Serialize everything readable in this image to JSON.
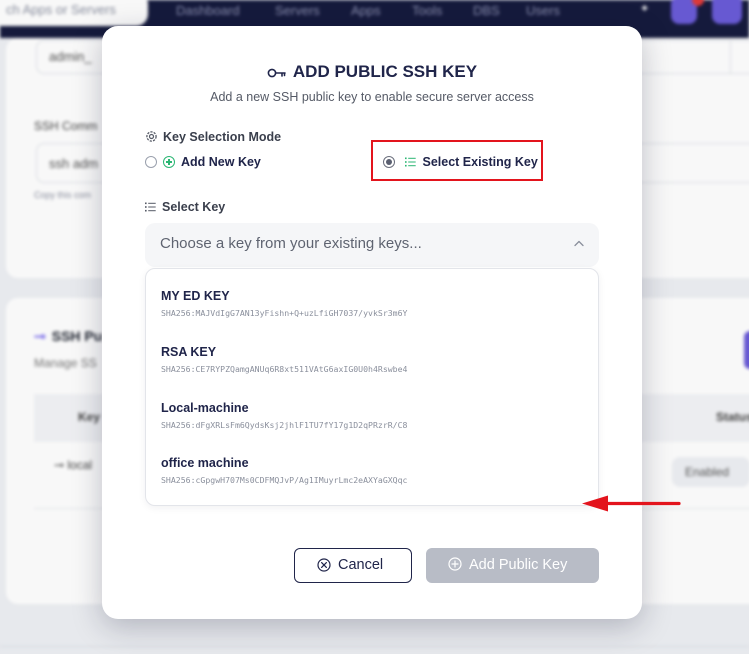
{
  "background": {
    "search_placeholder": "ch Apps or Servers",
    "nav": [
      "Dashboard",
      "Servers",
      "Apps",
      "Tools",
      "DBS",
      "Users"
    ],
    "field_value": "admin_",
    "ssh_label": "SSH Comm",
    "ssh_field_value": "ssh adm",
    "copy_hint": "Copy this com",
    "ssh_section_title": "SSH Pu",
    "ssh_section_sub": "Manage SS",
    "table_header_key": "Key",
    "table_header_status": "Status",
    "row_name": "local",
    "row_status": "Enabled"
  },
  "modal": {
    "title": "ADD PUBLIC SSH KEY",
    "subtitle": "Add a new SSH public key to enable secure server access",
    "mode_label": "Key Selection Mode",
    "mode_options": {
      "add_new": "Add New Key",
      "select_existing": "Select Existing Key",
      "selected": "select_existing"
    },
    "select_label": "Select Key",
    "select_placeholder": "Choose a key from your existing keys...",
    "keys": [
      {
        "name": "MY ED KEY",
        "fingerprint": "SHA256:MAJVdIgG7AN13yFishn+Q+uzLfiGH7037/yvkSr3m6Y"
      },
      {
        "name": "RSA KEY",
        "fingerprint": "SHA256:CE7RYPZQamgANUq6R8xt511VAtG6axIG0U0h4Rswbe4"
      },
      {
        "name": "Local-machine",
        "fingerprint": "SHA256:dFgXRLsFm6QydsKsj2jhlF1TU7fY17g1D2qPRzrR/C8"
      },
      {
        "name": "office machine",
        "fingerprint": "SHA256:cGpgwH707Ms0CDFMQJvP/Ag1IMuyrLmc2eAXYaGXQqc"
      }
    ],
    "cancel_label": "Cancel",
    "add_label": "Add Public Key"
  },
  "colors": {
    "highlight_box": "#e3141d",
    "annotation_arrow": "#e3141d",
    "title_navy": "#20254a",
    "add_button_disabled": "#b8bcc6"
  }
}
